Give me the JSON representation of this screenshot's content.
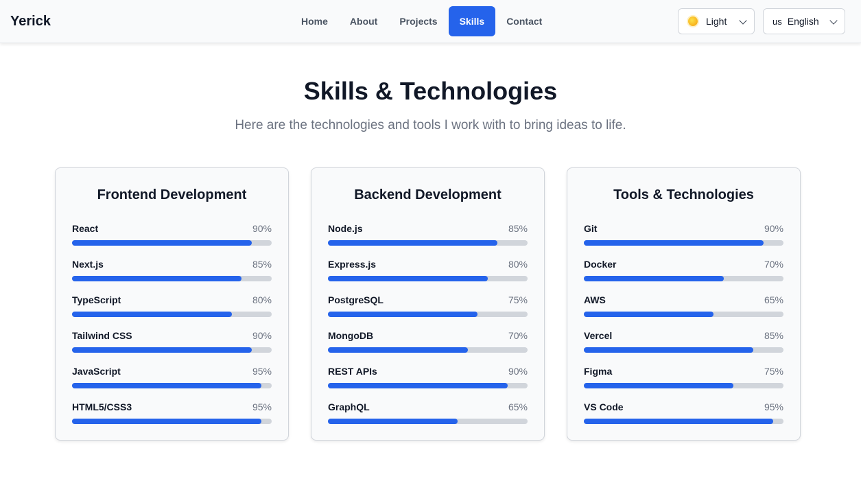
{
  "brand": "Yerick",
  "nav": [
    {
      "label": "Home",
      "active": false
    },
    {
      "label": "About",
      "active": false
    },
    {
      "label": "Projects",
      "active": false
    },
    {
      "label": "Skills",
      "active": true
    },
    {
      "label": "Contact",
      "active": false
    }
  ],
  "theme_select": {
    "icon": "sun-icon",
    "value": "Light"
  },
  "lang_select": {
    "flag": "us",
    "value": "English"
  },
  "page": {
    "title": "Skills & Technologies",
    "subtitle": "Here are the technologies and tools I work with to bring ideas to life."
  },
  "accent_color": "#2563eb",
  "categories": [
    {
      "title": "Frontend Development",
      "skills": [
        {
          "name": "React",
          "pct_label": "90%",
          "level": 90
        },
        {
          "name": "Next.js",
          "pct_label": "85%",
          "level": 85
        },
        {
          "name": "TypeScript",
          "pct_label": "80%",
          "level": 80
        },
        {
          "name": "Tailwind CSS",
          "pct_label": "90%",
          "level": 90
        },
        {
          "name": "JavaScript",
          "pct_label": "95%",
          "level": 95
        },
        {
          "name": "HTML5/CSS3",
          "pct_label": "95%",
          "level": 95
        }
      ]
    },
    {
      "title": "Backend Development",
      "skills": [
        {
          "name": "Node.js",
          "pct_label": "85%",
          "level": 85
        },
        {
          "name": "Express.js",
          "pct_label": "80%",
          "level": 80
        },
        {
          "name": "PostgreSQL",
          "pct_label": "75%",
          "level": 75
        },
        {
          "name": "MongoDB",
          "pct_label": "70%",
          "level": 70
        },
        {
          "name": "REST APIs",
          "pct_label": "90%",
          "level": 90
        },
        {
          "name": "GraphQL",
          "pct_label": "65%",
          "level": 65
        }
      ]
    },
    {
      "title": "Tools & Technologies",
      "skills": [
        {
          "name": "Git",
          "pct_label": "90%",
          "level": 90
        },
        {
          "name": "Docker",
          "pct_label": "70%",
          "level": 70
        },
        {
          "name": "AWS",
          "pct_label": "65%",
          "level": 65
        },
        {
          "name": "Vercel",
          "pct_label": "85%",
          "level": 85
        },
        {
          "name": "Figma",
          "pct_label": "75%",
          "level": 75
        },
        {
          "name": "VS Code",
          "pct_label": "95%",
          "level": 95
        }
      ]
    }
  ]
}
